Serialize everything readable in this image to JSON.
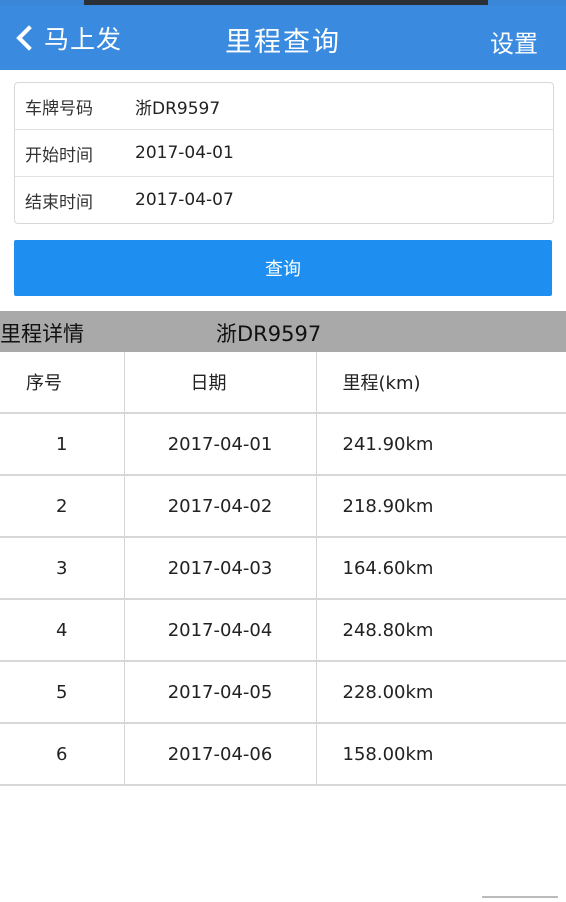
{
  "nav": {
    "back_label": "马上发",
    "title": "里程查询",
    "settings_label": "设置"
  },
  "form": {
    "plate_label": "车牌号码",
    "plate_value": "浙DR9597",
    "start_label": "开始时间",
    "start_value": "2017-04-01",
    "end_label": "结束时间",
    "end_value": "2017-04-07"
  },
  "query_button": "查询",
  "details": {
    "title": "里程详情",
    "plate": "浙DR9597"
  },
  "table": {
    "headers": [
      "序号",
      "日期",
      "里程(km)"
    ],
    "rows": [
      [
        "1",
        "2017-04-01",
        "241.90km"
      ],
      [
        "2",
        "2017-04-02",
        "218.90km"
      ],
      [
        "3",
        "2017-04-03",
        "164.60km"
      ],
      [
        "4",
        "2017-04-04",
        "248.80km"
      ],
      [
        "5",
        "2017-04-05",
        "228.00km"
      ],
      [
        "6",
        "2017-04-06",
        "158.00km"
      ]
    ]
  },
  "colors": {
    "nav_background": "#3a8be0",
    "button_background": "#1e8ff0",
    "detail_header_background": "#a9a9a9"
  }
}
